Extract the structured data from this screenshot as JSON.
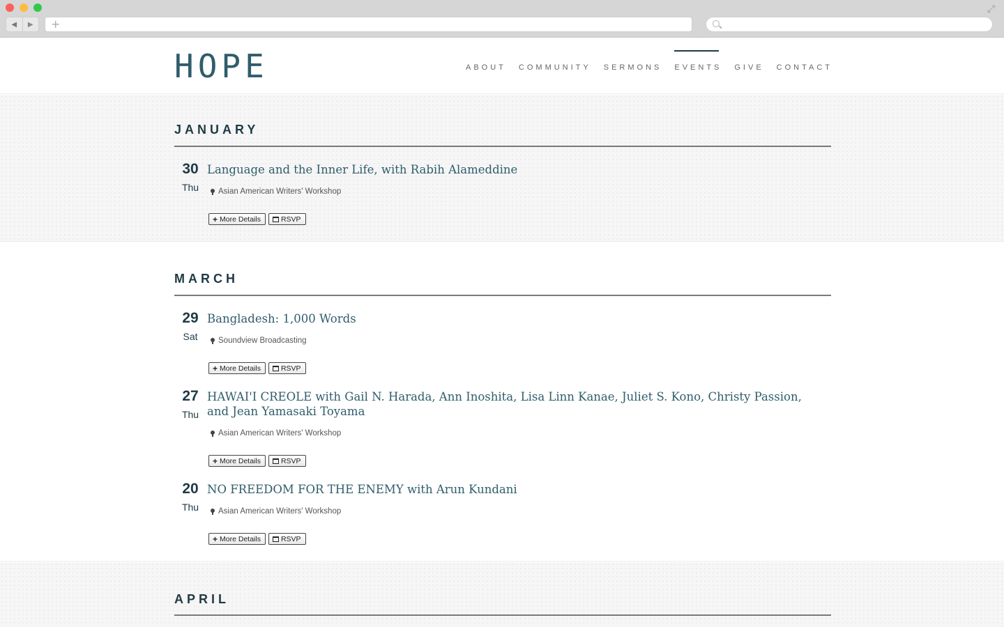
{
  "browser": {
    "back_icon": "◀",
    "forward_icon": "▶",
    "new_tab_icon": "+",
    "expand_icon": "⤢"
  },
  "site": {
    "logo": "HOPE",
    "nav": [
      {
        "label": "ABOUT",
        "active": false
      },
      {
        "label": "COMMUNITY",
        "active": false
      },
      {
        "label": "SERMONS",
        "active": false
      },
      {
        "label": "EVENTS",
        "active": true
      },
      {
        "label": "GIVE",
        "active": false
      },
      {
        "label": "CONTACT",
        "active": false
      }
    ],
    "colors": {
      "accent": "#2f5d6b",
      "heading": "#1f3a44"
    }
  },
  "buttons": {
    "details_label": "More Details",
    "rsvp_label": "RSVP"
  },
  "months": [
    {
      "name": "JANUARY",
      "events": [
        {
          "day": "30",
          "weekday": "Thu",
          "title": "Language and the Inner Life, with Rabih Alameddine",
          "location": "Asian American Writers' Workshop"
        }
      ]
    },
    {
      "name": "MARCH",
      "events": [
        {
          "day": "29",
          "weekday": "Sat",
          "title": "Bangladesh: 1,000 Words",
          "location": "Soundview Broadcasting"
        },
        {
          "day": "27",
          "weekday": "Thu",
          "title": "HAWAI'I CREOLE with Gail N. Harada, Ann Inoshita, Lisa Linn Kanae, Juliet S. Kono, Christy Passion, and Jean Yamasaki Toyama",
          "location": "Asian American Writers' Workshop"
        },
        {
          "day": "20",
          "weekday": "Thu",
          "title": "NO FREEDOM FOR THE ENEMY with Arun Kundani",
          "location": "Asian American Writers' Workshop"
        }
      ]
    },
    {
      "name": "APRIL",
      "events": []
    }
  ]
}
